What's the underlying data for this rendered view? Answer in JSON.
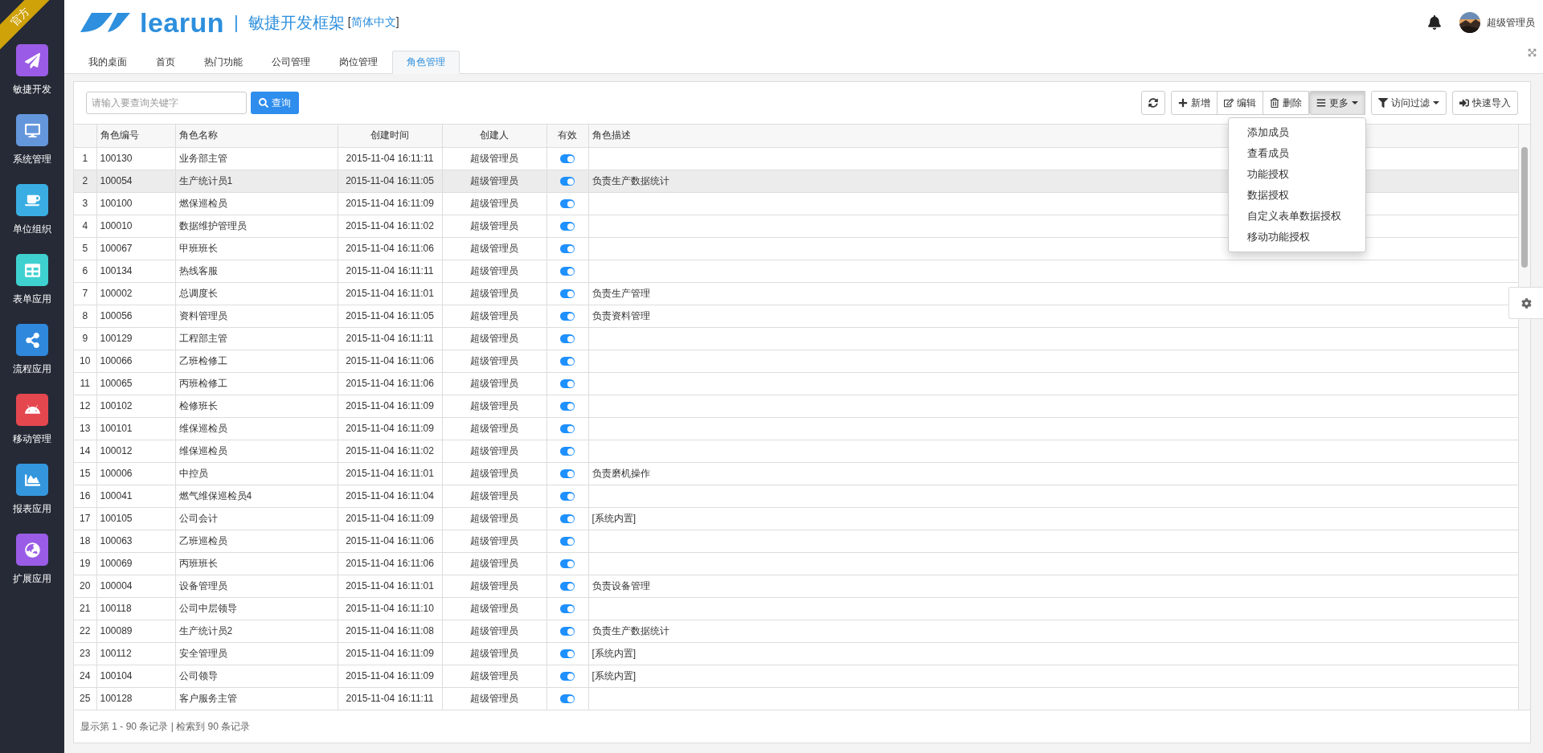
{
  "ribbon": "官方",
  "sidebar": {
    "items": [
      {
        "label": "敏捷开发",
        "color": "#9a5ce6"
      },
      {
        "label": "系统管理",
        "color": "#6496dc"
      },
      {
        "label": "单位组织",
        "color": "#3aaee2"
      },
      {
        "label": "表单应用",
        "color": "#3fd1cf"
      },
      {
        "label": "流程应用",
        "color": "#2f88dc"
      },
      {
        "label": "移动管理",
        "color": "#e5474f"
      },
      {
        "label": "报表应用",
        "color": "#3497de"
      },
      {
        "label": "扩展应用",
        "color": "#9a5ce6"
      }
    ]
  },
  "header": {
    "brand": "learun",
    "separator": "|",
    "product": "敏捷开发框架",
    "language_link": "简体中文",
    "language_open": "[",
    "language_close": "]",
    "user": "超级管理员"
  },
  "tabs": [
    {
      "label": "我的桌面",
      "selected": false
    },
    {
      "label": "首页",
      "selected": false
    },
    {
      "label": "热门功能",
      "selected": false
    },
    {
      "label": "公司管理",
      "selected": false
    },
    {
      "label": "岗位管理",
      "selected": false
    },
    {
      "label": "角色管理",
      "selected": true
    }
  ],
  "search": {
    "placeholder": "请输入要查询关键字",
    "button": "查询"
  },
  "toolbar": {
    "groups": [
      [
        {
          "caret": false,
          "expanded": false
        }
      ],
      [
        {
          "label": "新增",
          "caret": false,
          "expanded": false
        },
        {
          "label": "编辑",
          "caret": false,
          "expanded": false
        },
        {
          "label": "删除",
          "caret": false,
          "expanded": false
        },
        {
          "label": "更多",
          "caret": true,
          "expanded": true
        }
      ],
      [
        {
          "label": "访问过滤",
          "caret": true,
          "expanded": false
        }
      ],
      [
        {
          "label": "快速导入",
          "caret": false,
          "expanded": false
        }
      ]
    ]
  },
  "more_menu": [
    "添加成员",
    "查看成员",
    "功能授权",
    "数据授权",
    "自定义表单数据授权",
    "移动功能授权"
  ],
  "table": {
    "columns": [
      "角色编号",
      "角色名称",
      "创建时间",
      "创建人",
      "有效",
      "角色描述"
    ],
    "rows": [
      {
        "n": "1",
        "code": "100130",
        "name": "业务部主管",
        "time": "2015-11-04 16:11:11",
        "creator": "超级管理员",
        "on": true,
        "selected": false
      },
      {
        "n": "2",
        "code": "100054",
        "name": "生产统计员1",
        "time": "2015-11-04 16:11:05",
        "creator": "超级管理员",
        "on": true,
        "selected": true,
        "desc": "负责生产数据统计"
      },
      {
        "n": "3",
        "code": "100100",
        "name": "燃保巡检员",
        "time": "2015-11-04 16:11:09",
        "creator": "超级管理员",
        "on": true,
        "selected": false
      },
      {
        "n": "4",
        "code": "100010",
        "name": "数据维护管理员",
        "time": "2015-11-04 16:11:02",
        "creator": "超级管理员",
        "on": true,
        "selected": false
      },
      {
        "n": "5",
        "code": "100067",
        "name": "甲班班长",
        "time": "2015-11-04 16:11:06",
        "creator": "超级管理员",
        "on": true,
        "selected": false
      },
      {
        "n": "6",
        "code": "100134",
        "name": "热线客服",
        "time": "2015-11-04 16:11:11",
        "creator": "超级管理员",
        "on": true,
        "selected": false
      },
      {
        "n": "7",
        "code": "100002",
        "name": "总调度长",
        "time": "2015-11-04 16:11:01",
        "creator": "超级管理员",
        "on": true,
        "selected": false,
        "desc": "负责生产管理"
      },
      {
        "n": "8",
        "code": "100056",
        "name": "资料管理员",
        "time": "2015-11-04 16:11:05",
        "creator": "超级管理员",
        "on": true,
        "selected": false,
        "desc": "负责资料管理"
      },
      {
        "n": "9",
        "code": "100129",
        "name": "工程部主管",
        "time": "2015-11-04 16:11:11",
        "creator": "超级管理员",
        "on": true,
        "selected": false
      },
      {
        "n": "10",
        "code": "100066",
        "name": "乙班检修工",
        "time": "2015-11-04 16:11:06",
        "creator": "超级管理员",
        "on": true,
        "selected": false
      },
      {
        "n": "11",
        "code": "100065",
        "name": "丙班检修工",
        "time": "2015-11-04 16:11:06",
        "creator": "超级管理员",
        "on": true,
        "selected": false
      },
      {
        "n": "12",
        "code": "100102",
        "name": "检修班长",
        "time": "2015-11-04 16:11:09",
        "creator": "超级管理员",
        "on": true,
        "selected": false
      },
      {
        "n": "13",
        "code": "100101",
        "name": "维保巡检员",
        "time": "2015-11-04 16:11:09",
        "creator": "超级管理员",
        "on": true,
        "selected": false
      },
      {
        "n": "14",
        "code": "100012",
        "name": "维保巡检员",
        "time": "2015-11-04 16:11:02",
        "creator": "超级管理员",
        "on": true,
        "selected": false
      },
      {
        "n": "15",
        "code": "100006",
        "name": "中控员",
        "time": "2015-11-04 16:11:01",
        "creator": "超级管理员",
        "on": true,
        "selected": false,
        "desc": "负责磨机操作"
      },
      {
        "n": "16",
        "code": "100041",
        "name": "燃气维保巡检员4",
        "time": "2015-11-04 16:11:04",
        "creator": "超级管理员",
        "on": true,
        "selected": false
      },
      {
        "n": "17",
        "code": "100105",
        "name": "公司会计",
        "time": "2015-11-04 16:11:09",
        "creator": "超级管理员",
        "on": true,
        "selected": false,
        "desc": "[系统内置]"
      },
      {
        "n": "18",
        "code": "100063",
        "name": "乙班巡检员",
        "time": "2015-11-04 16:11:06",
        "creator": "超级管理员",
        "on": true,
        "selected": false
      },
      {
        "n": "19",
        "code": "100069",
        "name": "丙班班长",
        "time": "2015-11-04 16:11:06",
        "creator": "超级管理员",
        "on": true,
        "selected": false
      },
      {
        "n": "20",
        "code": "100004",
        "name": "设备管理员",
        "time": "2015-11-04 16:11:01",
        "creator": "超级管理员",
        "on": true,
        "selected": false,
        "desc": "负责设备管理"
      },
      {
        "n": "21",
        "code": "100118",
        "name": "公司中层领导",
        "time": "2015-11-04 16:11:10",
        "creator": "超级管理员",
        "on": true,
        "selected": false
      },
      {
        "n": "22",
        "code": "100089",
        "name": "生产统计员2",
        "time": "2015-11-04 16:11:08",
        "creator": "超级管理员",
        "on": true,
        "selected": false,
        "desc": "负责生产数据统计"
      },
      {
        "n": "23",
        "code": "100112",
        "name": "安全管理员",
        "time": "2015-11-04 16:11:09",
        "creator": "超级管理员",
        "on": true,
        "selected": false,
        "desc": "[系统内置]"
      },
      {
        "n": "24",
        "code": "100104",
        "name": "公司领导",
        "time": "2015-11-04 16:11:09",
        "creator": "超级管理员",
        "on": true,
        "selected": false,
        "desc": "[系统内置]"
      },
      {
        "n": "25",
        "code": "100128",
        "name": "客户服务主管",
        "time": "2015-11-04 16:11:11",
        "creator": "超级管理员",
        "on": true,
        "selected": false
      }
    ]
  },
  "footer": "显示第 1 - 90 条记录 | 检索到 90 条记录"
}
